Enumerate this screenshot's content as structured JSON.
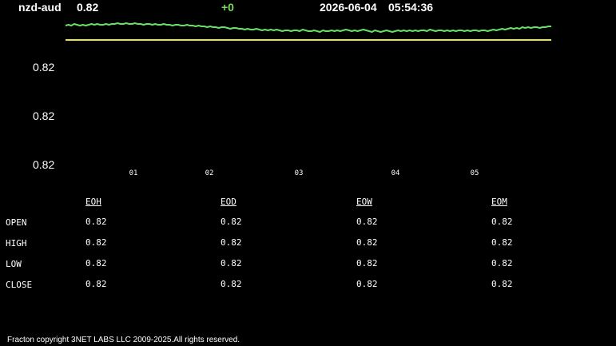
{
  "header": {
    "symbol": "nzd-aud",
    "price": "0.82",
    "change": "+0",
    "date": "2026-06-04",
    "time": "05:54:36",
    "change_color": "#7ddc5a"
  },
  "chart_data": {
    "type": "line",
    "y_tick_labels": [
      "0.82",
      "0.82",
      "0.82"
    ],
    "x_tick_labels": [
      "01",
      "02",
      "03",
      "04",
      "05"
    ],
    "ylim": [
      0.815,
      0.823
    ],
    "grid": false,
    "reference_line": {
      "value": 0.82,
      "color": "#e6e64a"
    },
    "series": [
      {
        "color": "#66e066",
        "values": [
          0.8218,
          0.8219,
          0.8218,
          0.822,
          0.8219,
          0.8218,
          0.8219,
          0.8218,
          0.8219,
          0.822,
          0.8219,
          0.822,
          0.8219,
          0.8219,
          0.822,
          0.8219,
          0.822,
          0.822,
          0.8221,
          0.822,
          0.822,
          0.8221,
          0.822,
          0.822,
          0.8221,
          0.822,
          0.822,
          0.8219,
          0.822,
          0.822,
          0.8219,
          0.822,
          0.8219,
          0.8219,
          0.822,
          0.8219,
          0.8219,
          0.8218,
          0.8219,
          0.8219,
          0.8218,
          0.8218,
          0.8219,
          0.8218,
          0.8218,
          0.8217,
          0.8218,
          0.8217,
          0.8217,
          0.8216,
          0.8217,
          0.8216,
          0.8216,
          0.8215,
          0.8216,
          0.8216,
          0.8215,
          0.8214,
          0.8215,
          0.8215,
          0.8214,
          0.8214,
          0.8213,
          0.8214,
          0.8213,
          0.8213,
          0.8214,
          0.8213,
          0.8212,
          0.8213,
          0.8212,
          0.8213,
          0.8212,
          0.8213,
          0.8212,
          0.8211,
          0.8212,
          0.8212,
          0.8211,
          0.8212,
          0.8212,
          0.8211,
          0.8213,
          0.8212,
          0.8211,
          0.8211,
          0.8212,
          0.8211,
          0.821,
          0.8212,
          0.8211,
          0.8211,
          0.8212,
          0.8211,
          0.8212,
          0.8211,
          0.8212,
          0.8213,
          0.8212,
          0.8211,
          0.8212,
          0.8211,
          0.8212,
          0.8213,
          0.8212,
          0.8211,
          0.821,
          0.8212,
          0.8211,
          0.821,
          0.8211,
          0.8212,
          0.8211,
          0.821,
          0.8211,
          0.8212,
          0.8211,
          0.8212,
          0.8211,
          0.8212,
          0.8211,
          0.8212,
          0.8211,
          0.8212,
          0.8212,
          0.8211,
          0.8213,
          0.8212,
          0.8211,
          0.8212,
          0.8212,
          0.8211,
          0.8212,
          0.8211,
          0.8212,
          0.8211,
          0.8212,
          0.8212,
          0.8211,
          0.8212,
          0.8211,
          0.8212,
          0.8212,
          0.8211,
          0.8212,
          0.8212,
          0.8211,
          0.8212,
          0.8213,
          0.8212,
          0.8213,
          0.8214,
          0.8213,
          0.8214,
          0.8215,
          0.8214,
          0.8215,
          0.8214,
          0.8216,
          0.8215,
          0.8216,
          0.8215,
          0.8216,
          0.8216,
          0.8215,
          0.8216,
          0.8216,
          0.8217,
          0.8217
        ]
      }
    ]
  },
  "table": {
    "columns": [
      "EOH",
      "EOD",
      "EOW",
      "EOM"
    ],
    "rows": [
      {
        "label": "OPEN",
        "values": [
          "0.82",
          "0.82",
          "0.82",
          "0.82"
        ]
      },
      {
        "label": "HIGH",
        "values": [
          "0.82",
          "0.82",
          "0.82",
          "0.82"
        ]
      },
      {
        "label": "LOW",
        "values": [
          "0.82",
          "0.82",
          "0.82",
          "0.82"
        ]
      },
      {
        "label": "CLOSE",
        "values": [
          "0.82",
          "0.82",
          "0.82",
          "0.82"
        ]
      }
    ]
  },
  "footer": {
    "text": "Fracton copyright 3NET LABS LLC 2009-2025.All rights reserved."
  }
}
